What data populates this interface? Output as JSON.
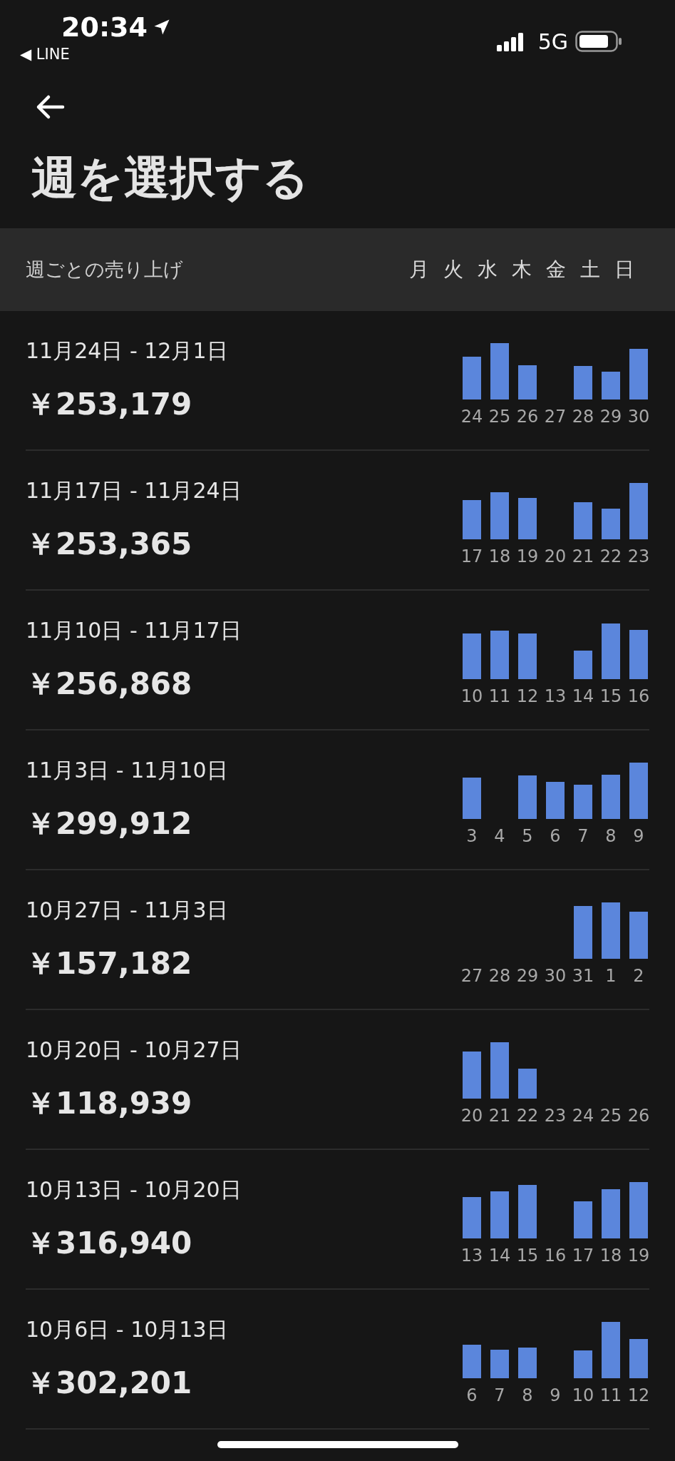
{
  "status_bar": {
    "time": "20:34",
    "back_app": "◀ LINE",
    "network": "5G"
  },
  "title": "週を選択する",
  "header": {
    "label": "週ごとの売り上げ",
    "weekdays": [
      "月",
      "火",
      "水",
      "木",
      "金",
      "土",
      "日"
    ]
  },
  "weeks": [
    {
      "range": "11月24日 - 12月1日",
      "amount": "￥253,179",
      "days": [
        "24",
        "25",
        "26",
        "27",
        "28",
        "29",
        "30"
      ]
    },
    {
      "range": "11月17日 - 11月24日",
      "amount": "￥253,365",
      "days": [
        "17",
        "18",
        "19",
        "20",
        "21",
        "22",
        "23"
      ]
    },
    {
      "range": "11月10日 - 11月17日",
      "amount": "￥256,868",
      "days": [
        "10",
        "11",
        "12",
        "13",
        "14",
        "15",
        "16"
      ]
    },
    {
      "range": "11月3日 - 11月10日",
      "amount": "￥299,912",
      "days": [
        "3",
        "4",
        "5",
        "6",
        "7",
        "8",
        "9"
      ]
    },
    {
      "range": "10月27日 - 11月3日",
      "amount": "￥157,182",
      "days": [
        "27",
        "28",
        "29",
        "30",
        "31",
        "1",
        "2"
      ]
    },
    {
      "range": "10月20日 - 10月27日",
      "amount": "￥118,939",
      "days": [
        "20",
        "21",
        "22",
        "23",
        "24",
        "25",
        "26"
      ]
    },
    {
      "range": "10月13日 - 10月20日",
      "amount": "￥316,940",
      "days": [
        "13",
        "14",
        "15",
        "16",
        "17",
        "18",
        "19"
      ]
    },
    {
      "range": "10月6日 - 10月13日",
      "amount": "￥302,201",
      "days": [
        "6",
        "7",
        "8",
        "9",
        "10",
        "11",
        "12"
      ]
    }
  ]
}
